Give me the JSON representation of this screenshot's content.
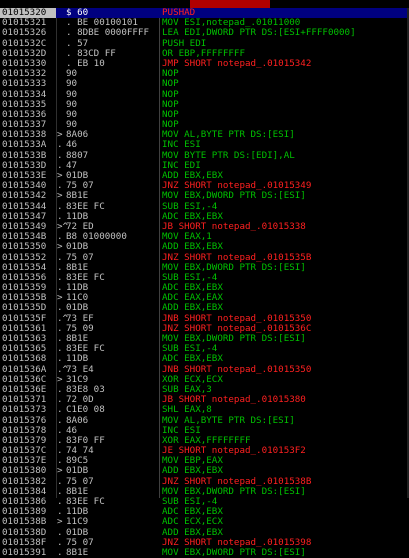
{
  "window": {
    "title_fragment": ""
  },
  "rows": [
    {
      "addr": "01015320",
      "mark": "",
      "hex": "$ 60",
      "asm": "PUSHAD",
      "cls": "",
      "sel": true
    },
    {
      "addr": "01015321",
      "mark": "",
      "hex": ". BE 00100101",
      "asm": "MOV ESI,notepad_.01011000",
      "cls": ""
    },
    {
      "addr": "01015326",
      "mark": "",
      "hex": ". 8DBE 0000FFFF",
      "asm": "LEA EDI,DWORD PTR DS:[ESI+FFFF0000]",
      "cls": ""
    },
    {
      "addr": "0101532C",
      "mark": "",
      "hex": ". 57",
      "asm": "PUSH EDI",
      "cls": ""
    },
    {
      "addr": "0101532D",
      "mark": "",
      "hex": ". 83CD FF",
      "asm": "OR EBP,FFFFFFFF",
      "cls": ""
    },
    {
      "addr": "01015330",
      "mark": "",
      "hex": ". EB 10",
      "asm": "JMP SHORT notepad_.01015342",
      "cls": "jmp"
    },
    {
      "addr": "01015332",
      "mark": "",
      "hex": "90",
      "asm": "NOP",
      "cls": ""
    },
    {
      "addr": "01015333",
      "mark": "",
      "hex": "90",
      "asm": "NOP",
      "cls": ""
    },
    {
      "addr": "01015334",
      "mark": "",
      "hex": "90",
      "asm": "NOP",
      "cls": ""
    },
    {
      "addr": "01015335",
      "mark": "",
      "hex": "90",
      "asm": "NOP",
      "cls": ""
    },
    {
      "addr": "01015336",
      "mark": "",
      "hex": "90",
      "asm": "NOP",
      "cls": ""
    },
    {
      "addr": "01015337",
      "mark": "",
      "hex": "90",
      "asm": "NOP",
      "cls": ""
    },
    {
      "addr": "01015338",
      "mark": ">",
      "hex": "8A06",
      "asm": "MOV AL,BYTE PTR DS:[ESI]",
      "cls": ""
    },
    {
      "addr": "0101533A",
      "mark": ".",
      "hex": "46",
      "asm": "INC ESI",
      "cls": ""
    },
    {
      "addr": "0101533B",
      "mark": ".",
      "hex": "8807",
      "asm": "MOV BYTE PTR DS:[EDI],AL",
      "cls": ""
    },
    {
      "addr": "0101533D",
      "mark": ".",
      "hex": "47",
      "asm": "INC EDI",
      "cls": ""
    },
    {
      "addr": "0101533E",
      "mark": ">",
      "hex": "01DB",
      "asm": "ADD EBX,EBX",
      "cls": ""
    },
    {
      "addr": "01015340",
      "mark": ".",
      "hex": "75 07",
      "asm": "JNZ SHORT notepad_.01015349",
      "cls": "jmp"
    },
    {
      "addr": "01015342",
      "mark": ">",
      "hex": "8B1E",
      "asm": "MOV EBX,DWORD PTR DS:[ESI]",
      "cls": ""
    },
    {
      "addr": "01015344",
      "mark": ".",
      "hex": "83EE FC",
      "asm": "SUB ESI,-4",
      "cls": ""
    },
    {
      "addr": "01015347",
      "mark": ".",
      "hex": "11DB",
      "asm": "ADC EBX,EBX",
      "cls": ""
    },
    {
      "addr": "01015349",
      "mark": ">^",
      "hex": "72 ED",
      "asm": "JB SHORT notepad_.01015338",
      "cls": "jmp"
    },
    {
      "addr": "0101534B",
      "mark": ".",
      "hex": "B8 01000000",
      "asm": "MOV EAX,1",
      "cls": ""
    },
    {
      "addr": "01015350",
      "mark": ">",
      "hex": "01DB",
      "asm": "ADD EBX,EBX",
      "cls": ""
    },
    {
      "addr": "01015352",
      "mark": ".",
      "hex": "75 07",
      "asm": "JNZ SHORT notepad_.0101535B",
      "cls": "jmp"
    },
    {
      "addr": "01015354",
      "mark": ".",
      "hex": "8B1E",
      "asm": "MOV EBX,DWORD PTR DS:[ESI]",
      "cls": ""
    },
    {
      "addr": "01015356",
      "mark": ".",
      "hex": "83EE FC",
      "asm": "SUB ESI,-4",
      "cls": ""
    },
    {
      "addr": "01015359",
      "mark": ".",
      "hex": "11DB",
      "asm": "ADC EBX,EBX",
      "cls": ""
    },
    {
      "addr": "0101535B",
      "mark": ">",
      "hex": "11C0",
      "asm": "ADC EAX,EAX",
      "cls": ""
    },
    {
      "addr": "0101535D",
      "mark": ".",
      "hex": "01DB",
      "asm": "ADD EBX,EBX",
      "cls": ""
    },
    {
      "addr": "0101535F",
      "mark": ".^",
      "hex": "73 EF",
      "asm": "JNB SHORT notepad_.01015350",
      "cls": "jmp"
    },
    {
      "addr": "01015361",
      "mark": ".",
      "hex": "75 09",
      "asm": "JNZ SHORT notepad_.0101536C",
      "cls": "jmp"
    },
    {
      "addr": "01015363",
      "mark": ".",
      "hex": "8B1E",
      "asm": "MOV EBX,DWORD PTR DS:[ESI]",
      "cls": ""
    },
    {
      "addr": "01015365",
      "mark": ".",
      "hex": "83EE FC",
      "asm": "SUB ESI,-4",
      "cls": ""
    },
    {
      "addr": "01015368",
      "mark": ".",
      "hex": "11DB",
      "asm": "ADC EBX,EBX",
      "cls": ""
    },
    {
      "addr": "0101536A",
      "mark": ".^",
      "hex": "73 E4",
      "asm": "JNB SHORT notepad_.01015350",
      "cls": "jmp"
    },
    {
      "addr": "0101536C",
      "mark": ">",
      "hex": "31C9",
      "asm": "XOR ECX,ECX",
      "cls": ""
    },
    {
      "addr": "0101536E",
      "mark": ".",
      "hex": "83E8 03",
      "asm": "SUB EAX,3",
      "cls": ""
    },
    {
      "addr": "01015371",
      "mark": ".",
      "hex": "72 0D",
      "asm": "JB SHORT notepad_.01015380",
      "cls": "jmp"
    },
    {
      "addr": "01015373",
      "mark": ".",
      "hex": "C1E0 08",
      "asm": "SHL EAX,8",
      "cls": ""
    },
    {
      "addr": "01015376",
      "mark": ".",
      "hex": "8A06",
      "asm": "MOV AL,BYTE PTR DS:[ESI]",
      "cls": ""
    },
    {
      "addr": "01015378",
      "mark": ".",
      "hex": "46",
      "asm": "INC ESI",
      "cls": ""
    },
    {
      "addr": "01015379",
      "mark": ".",
      "hex": "83F0 FF",
      "asm": "XOR EAX,FFFFFFFF",
      "cls": ""
    },
    {
      "addr": "0101537C",
      "mark": ".",
      "hex": "74 74",
      "asm": "JE SHORT notepad_.010153F2",
      "cls": "jmp"
    },
    {
      "addr": "0101537E",
      "mark": ".",
      "hex": "89C5",
      "asm": "MOV EBP,EAX",
      "cls": ""
    },
    {
      "addr": "01015380",
      "mark": ">",
      "hex": "01DB",
      "asm": "ADD EBX,EBX",
      "cls": ""
    },
    {
      "addr": "01015382",
      "mark": ".",
      "hex": "75 07",
      "asm": "JNZ SHORT notepad_.0101538B",
      "cls": "jmp"
    },
    {
      "addr": "01015384",
      "mark": ".",
      "hex": "8B1E",
      "asm": "MOV EBX,DWORD PTR DS:[ESI]",
      "cls": ""
    },
    {
      "addr": "01015386",
      "mark": ".",
      "hex": "83EE FC",
      "asm": "SUB ESI,-4",
      "cls": ""
    },
    {
      "addr": "01015389",
      "mark": ".",
      "hex": "11DB",
      "asm": "ADC EBX,EBX",
      "cls": ""
    },
    {
      "addr": "0101538B",
      "mark": ">",
      "hex": "11C9",
      "asm": "ADC ECX,ECX",
      "cls": ""
    },
    {
      "addr": "0101538D",
      "mark": ".",
      "hex": "01DB",
      "asm": "ADD EBX,EBX",
      "cls": ""
    },
    {
      "addr": "0101538F",
      "mark": ".",
      "hex": "75 07",
      "asm": "JNZ SHORT notepad_.01015398",
      "cls": "jmp"
    },
    {
      "addr": "01015391",
      "mark": ".",
      "hex": "8B1E",
      "asm": "MOV EBX,DWORD PTR DS:[ESI]",
      "cls": ""
    }
  ]
}
